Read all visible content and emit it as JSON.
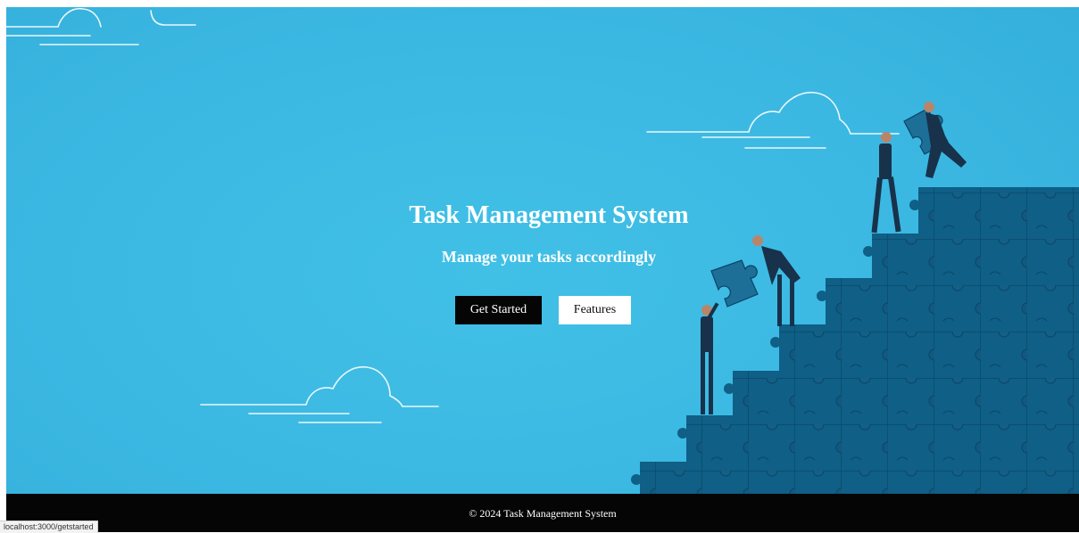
{
  "hero": {
    "title": "Task Management System",
    "subtitle": "Manage your tasks accordingly",
    "buttons": {
      "get_started": "Get Started",
      "features": "Features"
    },
    "illustration": "puzzle-teamwork-illustration"
  },
  "footer": {
    "copyright": "© 2024 Task Management System"
  },
  "status_bar": {
    "url": "localhost:3000/getstarted"
  },
  "colors": {
    "hero_background": "#3bb8e2",
    "puzzle_blue": "#0f5f86",
    "footer_background": "#050505",
    "primary_button": "#050505",
    "secondary_button": "#ffffff"
  }
}
